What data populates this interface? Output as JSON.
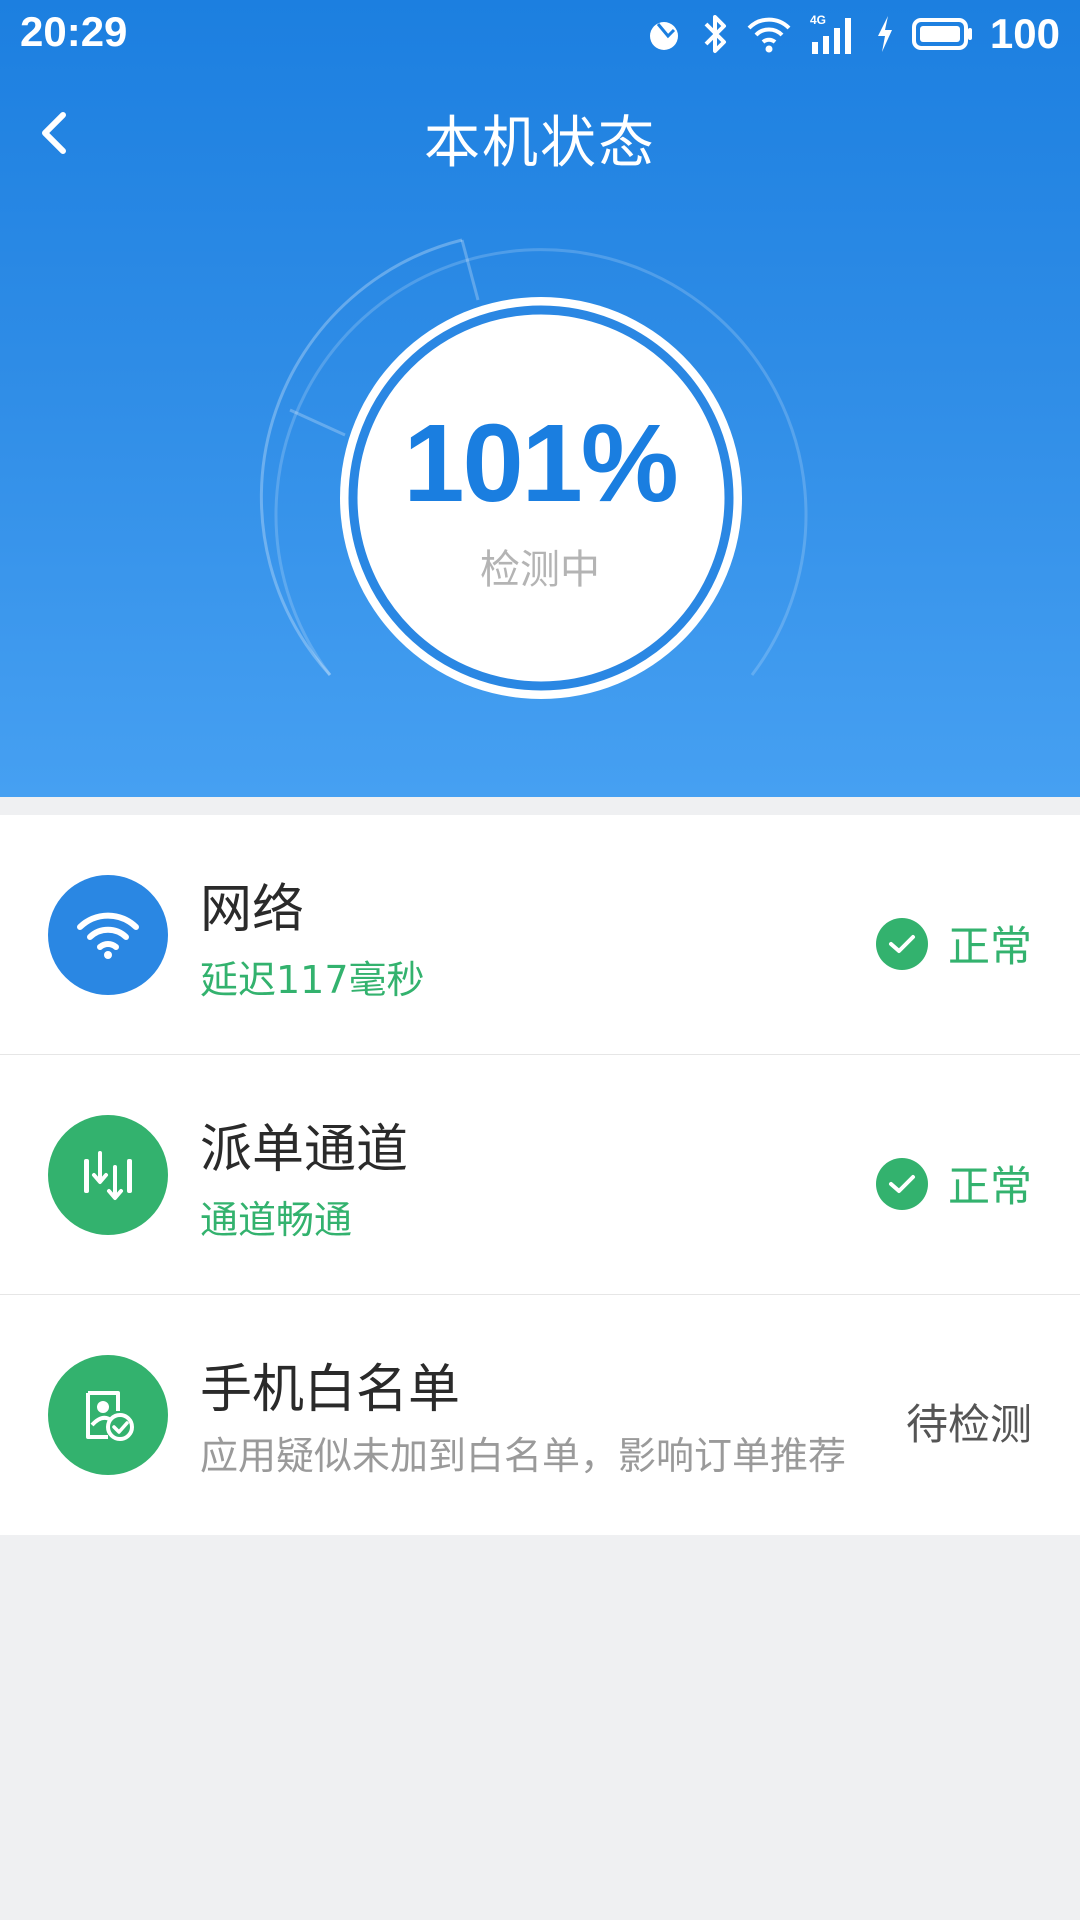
{
  "statusbar": {
    "time": "20:29",
    "network": "4G",
    "battery": "100"
  },
  "header": {
    "title": "本机状态",
    "back_icon": "chevron-left-icon"
  },
  "gauge": {
    "percent": "101%",
    "status": "检测中",
    "progress": 1.0
  },
  "items": [
    {
      "title": "网络",
      "subtitle": "延迟117毫秒",
      "status": "正常",
      "icon": "wifi-icon",
      "icon_color": "#2a87e3"
    },
    {
      "title": "派单通道",
      "subtitle": "通道畅通",
      "status": "正常",
      "icon": "order-channel-icon",
      "icon_color": "#33b26e"
    },
    {
      "title": "手机白名单",
      "subtitle": "应用疑似未加到白名单，影响订单推荐",
      "status": "待检测",
      "icon": "whitelist-icon",
      "icon_color": "#33b26e"
    }
  ],
  "colors": {
    "primary": "#1a7ee0",
    "success": "#33b26e",
    "muted": "#9a9a9a"
  }
}
